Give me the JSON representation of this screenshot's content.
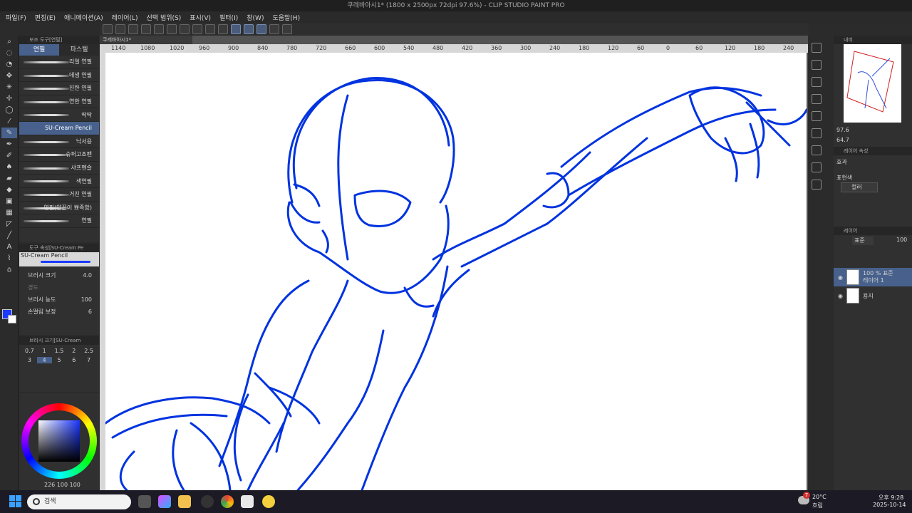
{
  "window": {
    "title": "쿠레바아시1* (1800 x 2500px 72dpi 97.6%) - CLIP STUDIO PAINT PRO"
  },
  "menu": [
    "파일(F)",
    "편집(E)",
    "애니메이션(A)",
    "레이어(L)",
    "선택 범위(S)",
    "표시(V)",
    "필터(I)",
    "창(W)",
    "도움말(H)"
  ],
  "subtool": {
    "panel_title": "보조 도구[연필]",
    "tabs": [
      "연필",
      "파스텔"
    ],
    "brushes": [
      "리얼 연필",
      "데생 연필",
      "진한 연필",
      "연한 연필",
      "딱딱",
      "SU-Cream Pencil",
      "낙서용",
      "슈퍼고조펜",
      "샤프펜슬",
      "색연필",
      "거친 연필",
      "연필(양끝이 뾰족함)",
      "연필"
    ],
    "selected_brush": "SU-Cream Pencil"
  },
  "tool_property": {
    "panel_title": "도구 속성[SU-Cream Pe",
    "brush_name": "SU-Cream Pencil",
    "brush_size_label": "브러시 크기",
    "brush_size_value": "4.0",
    "hardness_label": "경도",
    "density_label": "브러시 농도",
    "density_value": "100",
    "stabilization_label": "손떨림 보정",
    "stabilization_value": "6"
  },
  "brush_size_panel": {
    "panel_title": "브러시 크기[SU-Cream",
    "sizes": [
      "0.7",
      "1",
      "1.5",
      "2",
      "2.5",
      "3",
      "4",
      "5",
      "6",
      "7"
    ],
    "selected": "4"
  },
  "color": {
    "main": "#1a3aff",
    "sub": "#ffffff",
    "values_text": "226 100 100"
  },
  "document": {
    "tab": "쿠레바아시1*",
    "ruler_ticks": [
      "1140",
      "1080",
      "1020",
      "960",
      "900",
      "840",
      "780",
      "720",
      "660",
      "600",
      "540",
      "480",
      "420",
      "360",
      "300",
      "240",
      "180",
      "120",
      "60",
      "0",
      "60",
      "120",
      "180",
      "240"
    ],
    "stroke_color": "#0033e0"
  },
  "navigator": {
    "title": "내비",
    "zoom": "97.6",
    "angle": "64.7"
  },
  "layer_property": {
    "title": "레이어 속성",
    "effect_label": "효과",
    "expression_label": "표현색",
    "expression_value": "컬러"
  },
  "layers": {
    "title": "레이어",
    "blend_mode": "표준",
    "opacity": "100",
    "items": [
      {
        "name": "100 % 표준 레이어 1",
        "selected": true
      },
      {
        "name": "용지",
        "selected": false
      }
    ]
  },
  "taskbar": {
    "search_placeholder": "검색",
    "weather_temp": "20°C",
    "weather_desc": "흐림",
    "badge": "7",
    "time": "오후 9:28",
    "date": "2025-10-14"
  }
}
